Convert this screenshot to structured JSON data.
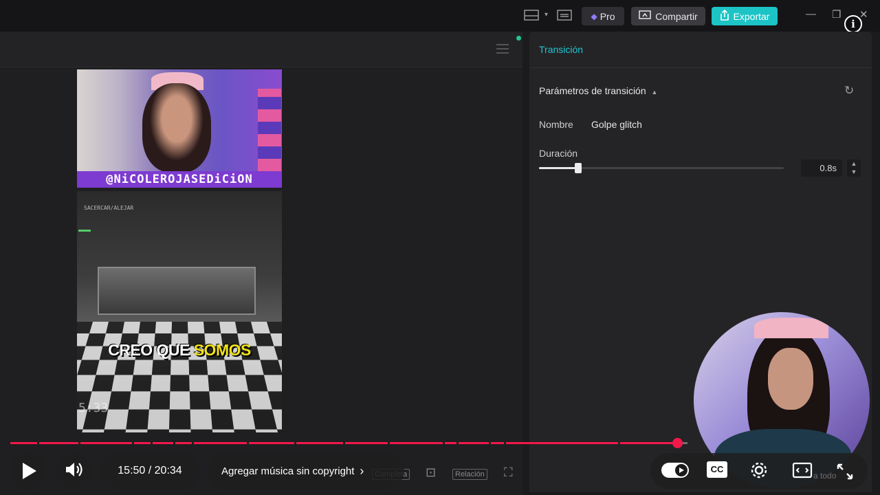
{
  "titlebar": {
    "pro_label": "Pro",
    "share_label": "Compartir",
    "export_label": "Exportar",
    "info_glyph": "i",
    "icons": [
      "layout-icon",
      "chevron-down-icon",
      "subtitles-icon",
      "minimize-icon",
      "maximize-icon",
      "close-icon"
    ]
  },
  "video": {
    "banner_text": "@NiCOLEROJASEDiCiON",
    "overlay_tag": "SACERCAR/ALEJAR",
    "caption_plain": "CREO QUE ",
    "caption_highlight": "SOMOS",
    "timestamp": "5:33"
  },
  "panel": {
    "tab_label": "Transición",
    "section_title": "Parámetros de transición",
    "name_label": "Nombre",
    "name_value": "Golpe glitch",
    "duration_label": "Duración",
    "duration_value": "0.8s",
    "duration_slider_fraction": 0.16
  },
  "player_controls": {
    "time_display": "15:50 / 20:34",
    "music_prompt": "Agregar música sin copyright",
    "ghost_full": "Completa",
    "ghost_ratio": "Relación",
    "progress_fraction": 0.985,
    "cc_label": "CC",
    "ghost_corner": "a todo"
  },
  "colors": {
    "accent_teal": "#1cc4c6",
    "progress_red": "#f2184a",
    "panel_tab": "#22c5d3"
  }
}
